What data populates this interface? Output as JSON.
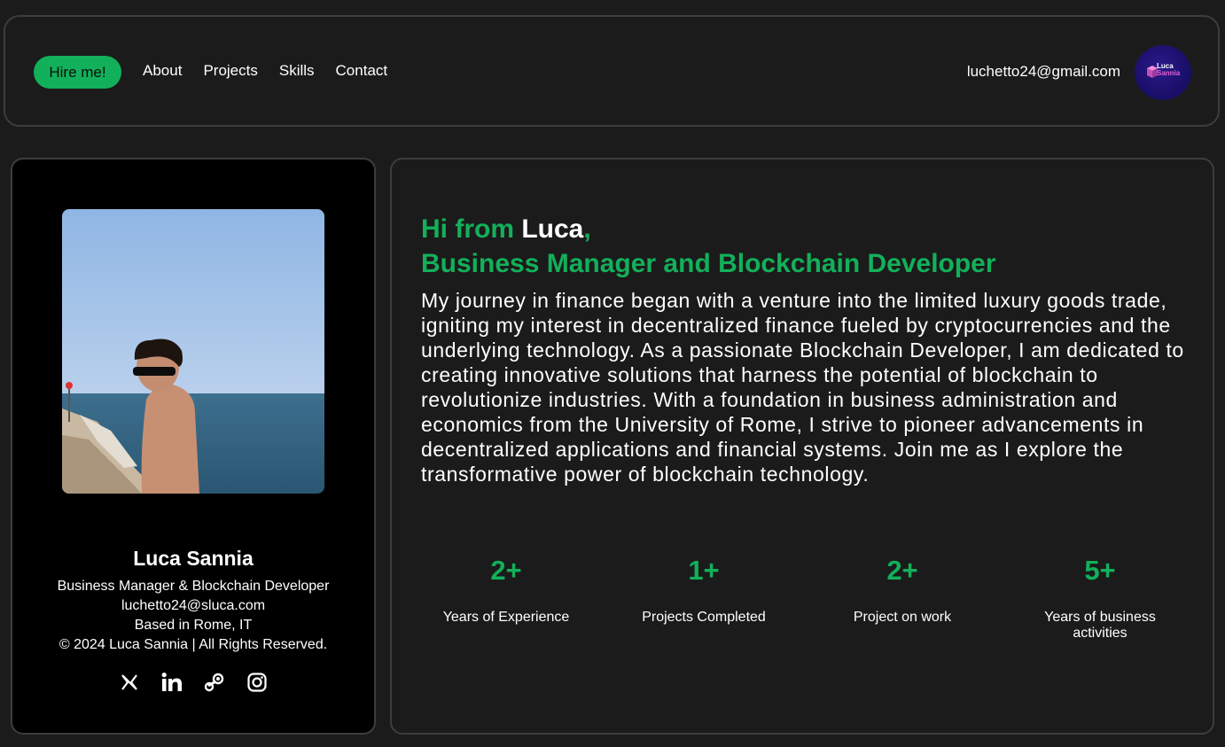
{
  "nav": {
    "hire_label": "Hire me!",
    "links": [
      "About",
      "Projects",
      "Skills",
      "Contact"
    ],
    "email": "luchetto24@gmail.com",
    "logo": {
      "line1": "Luca",
      "line2": "Sannia",
      "icon": "cube-logo-icon"
    }
  },
  "profile": {
    "name": "Luca Sannia",
    "role": "Business Manager & Blockchain Developer",
    "email": "luchetto24@sluca.com",
    "location": "Based in Rome, IT",
    "copyright": "© 2024 Luca Sannia | All Rights Reserved.",
    "socials": [
      "x-icon",
      "linkedin-icon",
      "steam-icon",
      "instagram-icon"
    ]
  },
  "hero": {
    "greeting_prefix": "Hi from ",
    "greeting_name": "Luca",
    "greeting_suffix": ",",
    "subtitle": "Business Manager and Blockchain Developer",
    "bio": "My journey in finance began with a venture into the limited luxury goods trade, igniting my interest in decentralized finance fueled by cryptocurrencies and the underlying technology. As a passionate Blockchain Developer, I am dedicated to creating innovative solutions that harness the potential of blockchain to revolutionize industries. With a foundation in business administration and economics from the University of Rome, I strive to pioneer advancements in decentralized applications and financial systems. Join me as I explore the transformative power of blockchain technology."
  },
  "stats": [
    {
      "value": "2+",
      "label": "Years of Experience"
    },
    {
      "value": "1+",
      "label": "Projects Completed"
    },
    {
      "value": "2+",
      "label": "Project on work"
    },
    {
      "value": "5+",
      "label": "Years of business activities"
    }
  ],
  "colors": {
    "accent": "#12b05a",
    "background": "#1b1b1b",
    "card": "#000000",
    "border": "#3d3d3d"
  }
}
